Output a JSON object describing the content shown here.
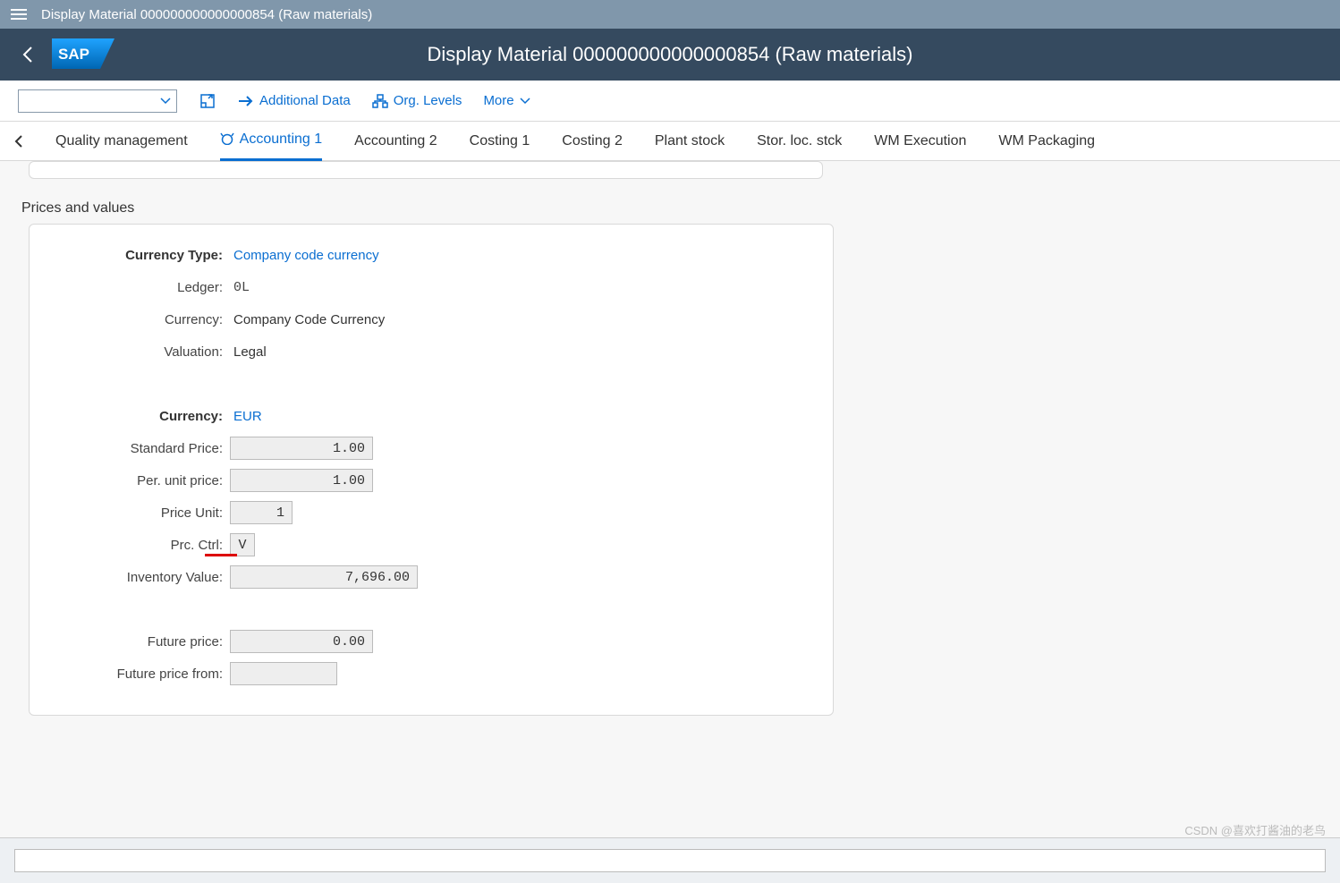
{
  "top": {
    "title": "Display Material 000000000000000854 (Raw materials)"
  },
  "header": {
    "title": "Display Material 000000000000000854 (Raw materials)"
  },
  "toolbar": {
    "additional_data": "Additional Data",
    "org_levels": "Org. Levels",
    "more": "More"
  },
  "tabs": {
    "prev": "Quality management",
    "items": [
      "Accounting 1",
      "Accounting 2",
      "Costing 1",
      "Costing 2",
      "Plant stock",
      "Stor. loc. stck",
      "WM Execution",
      "WM Packaging"
    ],
    "active_index": 0
  },
  "section": {
    "prices_title": "Prices and values"
  },
  "form": {
    "currency_type_label": "Currency Type:",
    "currency_type_value": "Company code currency",
    "ledger_label": "Ledger:",
    "ledger_value": "0L",
    "currency_desc_label": "Currency:",
    "currency_desc_value": "Company Code Currency",
    "valuation_label": "Valuation:",
    "valuation_value": "Legal",
    "currency_label": "Currency:",
    "currency_value": "EUR",
    "std_price_label": "Standard Price:",
    "std_price_value": "1.00",
    "per_unit_label": "Per. unit price:",
    "per_unit_value": "1.00",
    "price_unit_label": "Price Unit:",
    "price_unit_value": "1",
    "prc_ctrl_label": "Prc. Ctrl:",
    "prc_ctrl_value": "V",
    "inv_value_label": "Inventory Value:",
    "inv_value_value": "7,696.00",
    "future_price_label": "Future price:",
    "future_price_value": "0.00",
    "future_price_from_label": "Future price from:",
    "future_price_from_value": ""
  },
  "watermark": "CSDN @喜欢打酱油的老鸟"
}
